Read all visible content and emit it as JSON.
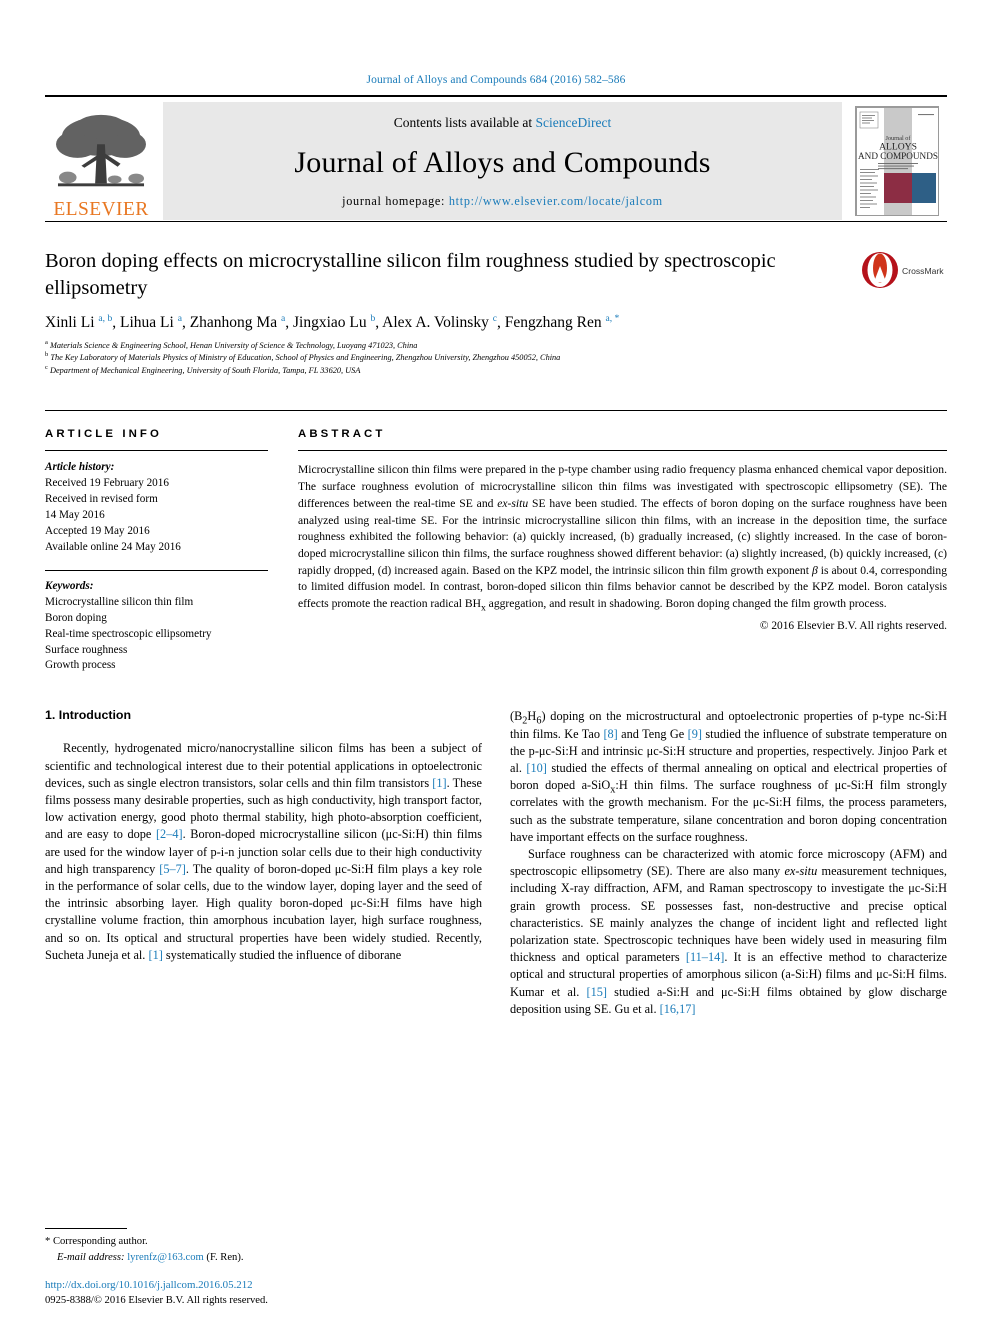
{
  "running_head": "Journal of Alloys and Compounds 684 (2016) 582–586",
  "masthead": {
    "publisher": "ELSEVIER",
    "contents_prefix": "Contents lists available at ",
    "contents_link": "ScienceDirect",
    "journal_title": "Journal of Alloys and Compounds",
    "homepage_prefix": "journal homepage: ",
    "homepage_url": "http://www.elsevier.com/locate/jalcom",
    "cover": {
      "line1": "Journal of",
      "line2": "ALLOYS",
      "line3": "AND COMPOUNDS"
    },
    "colors": {
      "link": "#1a7bb9",
      "elsevier_orange": "#e87722",
      "cover_maroon": "#8c2d44",
      "cover_blue": "#2e5f86",
      "cover_grey": "#c9c9c9"
    }
  },
  "article": {
    "title": "Boron doping effects on microcrystalline silicon film roughness studied by spectroscopic ellipsometry",
    "crossmark_label": "CrossMark",
    "authors_html": "Xinli Li <sup>a, b</sup>, Lihua Li <sup>a</sup>, Zhanhong Ma <sup>a</sup>, Jingxiao Lu <sup>b</sup>, Alex A. Volinsky <sup>c</sup>, Fengzhang Ren <sup>a, *</sup>",
    "affiliations": [
      "Materials Science & Engineering School, Henan University of Science & Technology, Luoyang 471023, China",
      "The Key Laboratory of Materials Physics of Ministry of Education, School of Physics and Engineering, Zhengzhou University, Zhengzhou 450052, China",
      "Department of Mechanical Engineering, University of South Florida, Tampa, FL 33620, USA"
    ],
    "affiliation_marks": [
      "a",
      "b",
      "c"
    ]
  },
  "article_info": {
    "heading": "ARTICLE INFO",
    "history_label": "Article history:",
    "history": [
      "Received 19 February 2016",
      "Received in revised form",
      "14 May 2016",
      "Accepted 19 May 2016",
      "Available online 24 May 2016"
    ],
    "keywords_label": "Keywords:",
    "keywords": [
      "Microcrystalline silicon thin film",
      "Boron doping",
      "Real-time spectroscopic ellipsometry",
      "Surface roughness",
      "Growth process"
    ]
  },
  "abstract": {
    "heading": "ABSTRACT",
    "text_part1": "Microcrystalline silicon thin films were prepared in the p-type chamber using radio frequency plasma enhanced chemical vapor deposition. The surface roughness evolution of microcrystalline silicon thin films was investigated with spectroscopic ellipsometry (SE). The differences between the real-time SE and ",
    "italic1": "ex-situ",
    "text_part2": " SE have been studied. The effects of boron doping on the surface roughness have been analyzed using real-time SE. For the intrinsic microcrystalline silicon thin films, with an increase in the deposition time, the surface roughness exhibited the following behavior: (a) quickly increased, (b) gradually increased, (c) slightly increased. In the case of boron-doped microcrystalline silicon thin films, the surface roughness showed different behavior: (a) slightly increased, (b) quickly increased, (c) rapidly dropped, (d) increased again. Based on the KPZ model, the intrinsic silicon thin film growth exponent ",
    "italic2": "β",
    "text_part3": " is about 0.4, corresponding to limited diffusion model. In contrast, boron-doped silicon thin films behavior cannot be described by the KPZ model. Boron catalysis effects promote the reaction radical BH",
    "subscript1": "x",
    "text_part4": " aggregation, and result in shadowing. Boron doping changed the film growth process.",
    "copyright": "© 2016 Elsevier B.V. All rights reserved."
  },
  "introduction": {
    "heading": "1. Introduction",
    "left_p1_a": "Recently, hydrogenated micro/nanocrystalline silicon films has been a subject of scientific and technological interest due to their potential applications in optoelectronic devices, such as single electron transistors, solar cells and thin film transistors ",
    "ref_1a": "[1]",
    "left_p1_b": ". These films possess many desirable properties, such as high conductivity, high transport factor, low activation energy, good photo thermal stability, high photo-absorption coefficient, and are easy to dope ",
    "ref_2_4": "[2–4]",
    "left_p1_c": ". Boron-doped microcrystalline silicon (μc-Si:H) thin films are used for the window layer of p-i-n junction solar cells due to their high conductivity and high transparency ",
    "ref_5_7": "[5–7]",
    "left_p1_d": ". The quality of boron-doped μc-Si:H film plays a key role in the performance of solar cells, due to the window layer, doping layer and the seed of the intrinsic absorbing layer. High quality boron-doped μc-Si:H films have high crystalline volume fraction, thin amorphous incubation layer, high surface roughness, and so on. Its optical and structural properties have been widely studied. Recently, Sucheta Juneja et al. ",
    "ref_1b": "[1]",
    "left_p1_e": " systematically studied the influence of diborane",
    "right_p1_a": "(B",
    "right_sub_2": "2",
    "right_p1_b": "H",
    "right_sub_6": "6",
    "right_p1_c": ") doping on the microstructural and optoelectronic properties of p-type nc-Si:H thin films. Ke Tao ",
    "ref_8": "[8]",
    "right_p1_d": " and Teng Ge ",
    "ref_9": "[9]",
    "right_p1_e": " studied the influence of substrate temperature on the p-μc-Si:H and intrinsic μc-Si:H structure and properties, respectively. Jinjoo Park et al. ",
    "ref_10": "[10]",
    "right_p1_f": " studied the effects of thermal annealing on optical and electrical properties of boron doped a-SiO",
    "right_sub_x": "x",
    "right_p1_g": ":H thin films. The surface roughness of μc-Si:H film strongly correlates with the growth mechanism. For the μc-Si:H films, the process parameters, such as the substrate temperature, silane concentration and boron doping concentration have important effects on the surface roughness.",
    "right_p2_a": "Surface roughness can be characterized with atomic force microscopy (AFM) and spectroscopic ellipsometry (SE). There are also many ",
    "right_ital_exsitu": "ex-situ",
    "right_p2_b": " measurement techniques, including X-ray diffraction, AFM, and Raman spectroscopy to investigate the μc-Si:H grain growth process. SE possesses fast, non-destructive and precise optical characteristics. SE mainly analyzes the change of incident light and reflected light polarization state. Spectroscopic techniques have been widely used in measuring film thickness and optical parameters ",
    "ref_11_14": "[11–14]",
    "right_p2_c": ". It is an effective method to characterize optical and structural properties of amorphous silicon (a-Si:H) films and μc-Si:H films. Kumar et al. ",
    "ref_15": "[15]",
    "right_p2_d": " studied a-Si:H and μc-Si:H films obtained by glow discharge deposition using SE. Gu et al. ",
    "ref_16_17": "[16,17]"
  },
  "footer": {
    "corresponding": "* Corresponding author.",
    "email_label": "E-mail address:",
    "email": "lyrenfz@163.com",
    "email_suffix": "(F. Ren).",
    "doi": "http://dx.doi.org/10.1016/j.jallcom.2016.05.212",
    "issn": "0925-8388/© 2016 Elsevier B.V. All rights reserved."
  }
}
